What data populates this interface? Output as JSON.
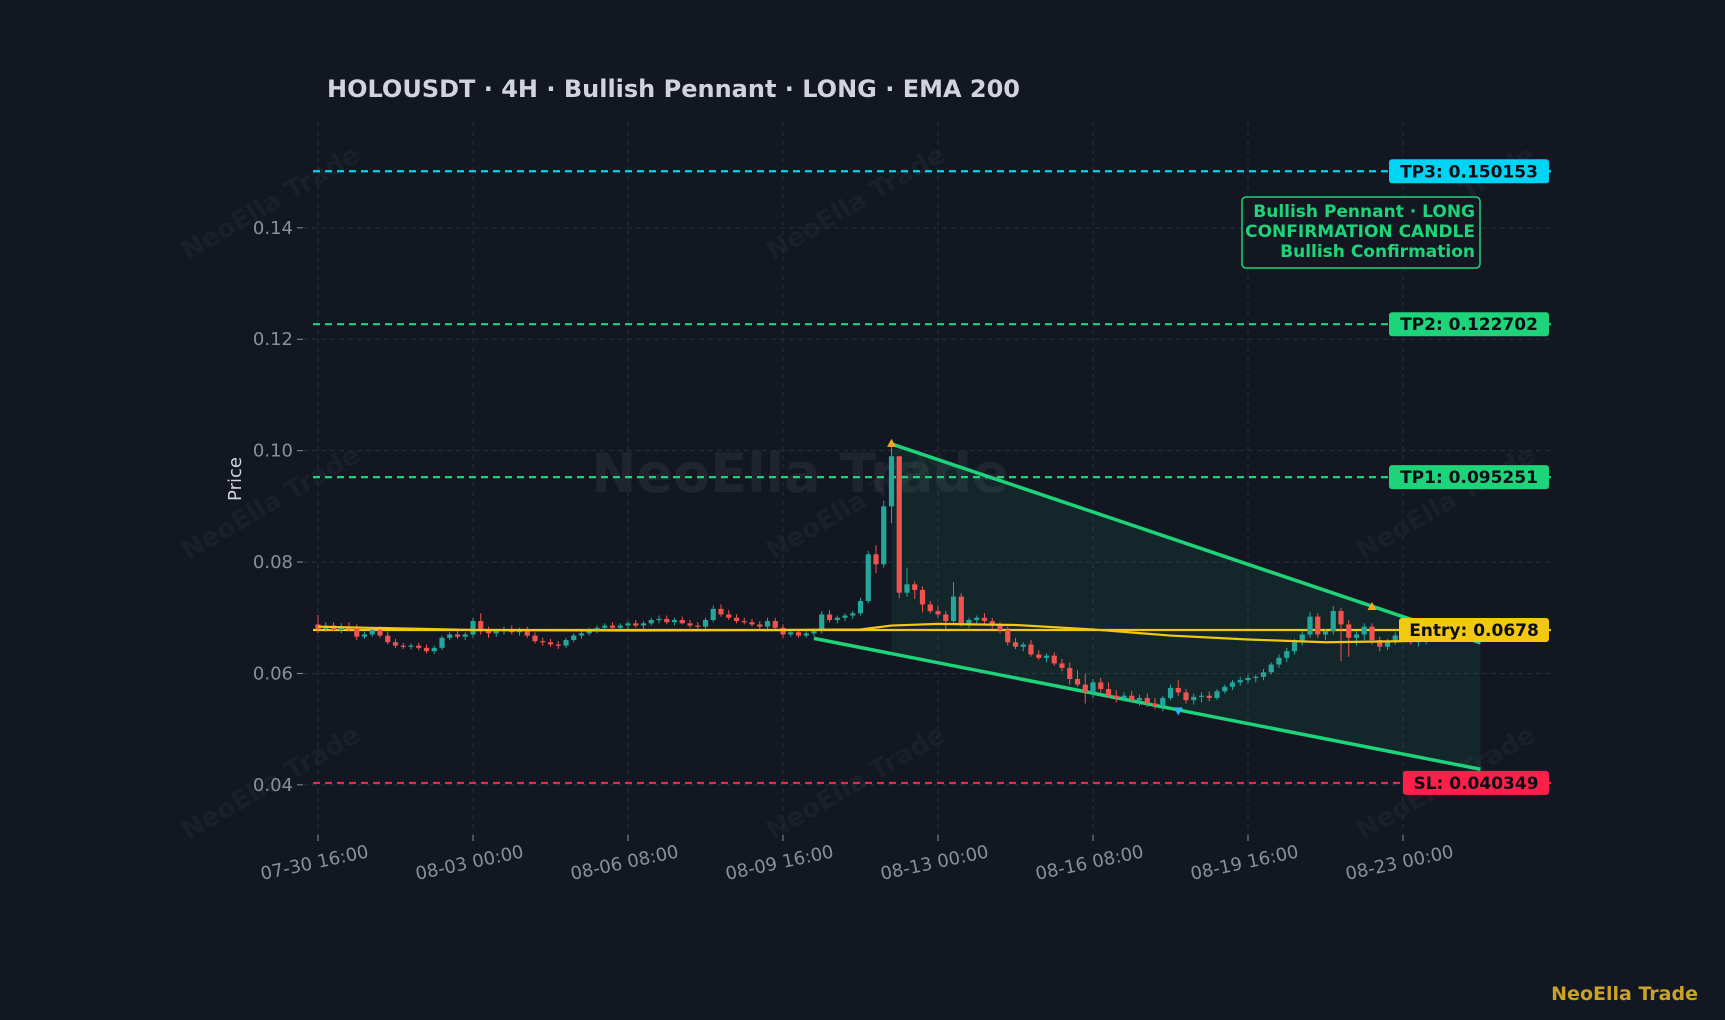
{
  "header": {
    "title": "HOLOUSDT  ·  4H  ·  Bullish Pennant  ·  LONG  ·  EMA 200"
  },
  "brand": "NeoElla Trade",
  "watermark": "NeoElla Trade",
  "annotation": {
    "lines": [
      "Bullish Pennant · LONG",
      "CONFIRMATION CANDLE",
      "Bullish Confirmation"
    ]
  },
  "colors": {
    "background": "#131722",
    "grid": "#2a2e39",
    "candle_up": "#26a69a",
    "candle_down": "#ef5350",
    "pattern": "#1ed47a",
    "ema": "#f2c811",
    "tp3": "#00d4f5",
    "tp2": "#1ed47a",
    "tp1": "#1ed47a",
    "entry": "#f2c811",
    "sl": "#ff1f4b",
    "brand": "#c9a227"
  },
  "chart_data": {
    "type": "candlestick",
    "timeframe": "4H",
    "symbol": "HOLOUSDT",
    "title": "HOLOUSDT  ·  4H  ·  Bullish Pennant  ·  LONG  ·  EMA 200",
    "ylabel": "Price",
    "ylim": [
      0.031,
      0.159
    ],
    "yticks": [
      0.04,
      0.06,
      0.08,
      0.1,
      0.12,
      0.14
    ],
    "ytick_labels": [
      "0.04",
      "0.06",
      "0.08",
      "0.10",
      "0.12",
      "0.14"
    ],
    "xlim_bars": [
      -1,
      169
    ],
    "xticks": [
      {
        "bar": 0,
        "label": "07-30 16:00"
      },
      {
        "bar": 20,
        "label": "08-03 00:00"
      },
      {
        "bar": 40,
        "label": "08-06 08:00"
      },
      {
        "bar": 60,
        "label": "08-09 16:00"
      },
      {
        "bar": 80,
        "label": "08-13 00:00"
      },
      {
        "bar": 100,
        "label": "08-16 08:00"
      },
      {
        "bar": 120,
        "label": "08-19 16:00"
      },
      {
        "bar": 140,
        "label": "08-23 00:00"
      }
    ],
    "grid": true,
    "levels": [
      {
        "key": "tp3",
        "label": "TP3: 0.150153",
        "value": 0.150153
      },
      {
        "key": "tp2",
        "label": "TP2: 0.122702",
        "value": 0.122702
      },
      {
        "key": "tp1",
        "label": "TP1: 0.095251",
        "value": 0.095251
      },
      {
        "key": "entry",
        "label": "Entry: 0.0678",
        "value": 0.0678
      },
      {
        "key": "sl",
        "label": "SL: 0.040349",
        "value": 0.040349
      }
    ],
    "pattern": {
      "name": "Bullish Pennant",
      "upper_line": [
        [
          74,
          0.1012
        ],
        [
          150,
          0.0655
        ]
      ],
      "lower_line": [
        [
          64,
          0.0663
        ],
        [
          150,
          0.0428
        ]
      ],
      "markers": [
        {
          "bar": 74,
          "price": 0.1014,
          "dir": "up"
        },
        {
          "bar": 111,
          "price": 0.0532,
          "dir": "down"
        },
        {
          "bar": 136,
          "price": 0.0721,
          "dir": "up"
        }
      ]
    },
    "ema_200": [
      [
        0,
        0.0684
      ],
      [
        20,
        0.0678
      ],
      [
        40,
        0.0677
      ],
      [
        60,
        0.0678
      ],
      [
        70,
        0.0679
      ],
      [
        74,
        0.0686
      ],
      [
        80,
        0.0689
      ],
      [
        90,
        0.0687
      ],
      [
        100,
        0.0679
      ],
      [
        110,
        0.0668
      ],
      [
        120,
        0.0661
      ],
      [
        130,
        0.0656
      ],
      [
        140,
        0.0658
      ],
      [
        150,
        0.0661
      ]
    ],
    "candles": [
      [
        0.0688,
        0.0705,
        0.0672,
        0.068
      ],
      [
        0.068,
        0.0692,
        0.0674,
        0.0686
      ],
      [
        0.0686,
        0.0692,
        0.0676,
        0.0678
      ],
      [
        0.0678,
        0.069,
        0.0672,
        0.0684
      ],
      [
        0.0684,
        0.0692,
        0.0676,
        0.068
      ],
      [
        0.068,
        0.0688,
        0.066,
        0.0666
      ],
      [
        0.0666,
        0.0675,
        0.0662,
        0.067
      ],
      [
        0.067,
        0.0682,
        0.0666,
        0.0678
      ],
      [
        0.0678,
        0.0685,
        0.0664,
        0.0668
      ],
      [
        0.0668,
        0.0675,
        0.0652,
        0.0656
      ],
      [
        0.0656,
        0.0662,
        0.0646,
        0.065
      ],
      [
        0.065,
        0.0655,
        0.0644,
        0.0648
      ],
      [
        0.0648,
        0.0654,
        0.0643,
        0.065
      ],
      [
        0.065,
        0.0655,
        0.0642,
        0.0646
      ],
      [
        0.0646,
        0.0652,
        0.0636,
        0.064
      ],
      [
        0.064,
        0.065,
        0.0635,
        0.0646
      ],
      [
        0.0646,
        0.0668,
        0.0642,
        0.0664
      ],
      [
        0.0664,
        0.0674,
        0.066,
        0.067
      ],
      [
        0.067,
        0.0676,
        0.0662,
        0.0666
      ],
      [
        0.0666,
        0.0674,
        0.066,
        0.067
      ],
      [
        0.067,
        0.07,
        0.0664,
        0.0694
      ],
      [
        0.0694,
        0.0708,
        0.067,
        0.0676
      ],
      [
        0.0676,
        0.0684,
        0.0664,
        0.0672
      ],
      [
        0.0672,
        0.068,
        0.0666,
        0.0676
      ],
      [
        0.0676,
        0.0684,
        0.067,
        0.0678
      ],
      [
        0.0678,
        0.0686,
        0.067,
        0.0674
      ],
      [
        0.0674,
        0.0682,
        0.0668,
        0.068
      ],
      [
        0.068,
        0.0684,
        0.0664,
        0.0668
      ],
      [
        0.0668,
        0.0674,
        0.0654,
        0.0658
      ],
      [
        0.0658,
        0.0664,
        0.065,
        0.0656
      ],
      [
        0.0656,
        0.0662,
        0.0648,
        0.0652
      ],
      [
        0.0652,
        0.0658,
        0.0644,
        0.065
      ],
      [
        0.065,
        0.0664,
        0.0646,
        0.066
      ],
      [
        0.066,
        0.0672,
        0.0656,
        0.0668
      ],
      [
        0.0668,
        0.0676,
        0.0662,
        0.0672
      ],
      [
        0.0672,
        0.0682,
        0.0668,
        0.0678
      ],
      [
        0.0678,
        0.0686,
        0.0672,
        0.0682
      ],
      [
        0.0682,
        0.069,
        0.0676,
        0.0686
      ],
      [
        0.0686,
        0.0692,
        0.0678,
        0.0682
      ],
      [
        0.0682,
        0.069,
        0.0676,
        0.0686
      ],
      [
        0.0686,
        0.0694,
        0.068,
        0.069
      ],
      [
        0.069,
        0.0696,
        0.0682,
        0.0686
      ],
      [
        0.0686,
        0.0694,
        0.068,
        0.069
      ],
      [
        0.069,
        0.07,
        0.0686,
        0.0696
      ],
      [
        0.0696,
        0.0704,
        0.069,
        0.0698
      ],
      [
        0.0698,
        0.0704,
        0.0688,
        0.0692
      ],
      [
        0.0692,
        0.07,
        0.0686,
        0.0696
      ],
      [
        0.0696,
        0.0702,
        0.0688,
        0.069
      ],
      [
        0.069,
        0.0696,
        0.0682,
        0.0686
      ],
      [
        0.0686,
        0.0692,
        0.068,
        0.0684
      ],
      [
        0.0684,
        0.07,
        0.068,
        0.0696
      ],
      [
        0.0696,
        0.0722,
        0.0692,
        0.0716
      ],
      [
        0.0716,
        0.0724,
        0.0702,
        0.0706
      ],
      [
        0.0706,
        0.0714,
        0.0696,
        0.07
      ],
      [
        0.07,
        0.0706,
        0.069,
        0.0694
      ],
      [
        0.0694,
        0.07,
        0.0688,
        0.0692
      ],
      [
        0.0692,
        0.0698,
        0.0684,
        0.0688
      ],
      [
        0.0688,
        0.0694,
        0.068,
        0.0684
      ],
      [
        0.0684,
        0.07,
        0.068,
        0.0694
      ],
      [
        0.0694,
        0.07,
        0.0678,
        0.0682
      ],
      [
        0.0682,
        0.0688,
        0.0664,
        0.067
      ],
      [
        0.067,
        0.0678,
        0.0666,
        0.0674
      ],
      [
        0.0674,
        0.068,
        0.0664,
        0.0668
      ],
      [
        0.0668,
        0.0676,
        0.0664,
        0.0672
      ],
      [
        0.0672,
        0.068,
        0.0666,
        0.0676
      ],
      [
        0.0676,
        0.0712,
        0.0672,
        0.0706
      ],
      [
        0.0706,
        0.0714,
        0.0692,
        0.0696
      ],
      [
        0.0696,
        0.0704,
        0.069,
        0.07
      ],
      [
        0.07,
        0.0708,
        0.0694,
        0.0704
      ],
      [
        0.0704,
        0.0712,
        0.0698,
        0.0708
      ],
      [
        0.0708,
        0.0736,
        0.0704,
        0.073
      ],
      [
        0.073,
        0.082,
        0.0726,
        0.0814
      ],
      [
        0.0814,
        0.083,
        0.078,
        0.0796
      ],
      [
        0.0796,
        0.091,
        0.079,
        0.09
      ],
      [
        0.09,
        0.1014,
        0.087,
        0.099
      ],
      [
        0.099,
        0.0965,
        0.0735,
        0.0745
      ],
      [
        0.0745,
        0.079,
        0.0738,
        0.076
      ],
      [
        0.076,
        0.0765,
        0.0734,
        0.075
      ],
      [
        0.075,
        0.0756,
        0.071,
        0.0724
      ],
      [
        0.0724,
        0.073,
        0.0708,
        0.0712
      ],
      [
        0.0712,
        0.0722,
        0.07,
        0.0706
      ],
      [
        0.0706,
        0.0712,
        0.068,
        0.0694
      ],
      [
        0.0694,
        0.0764,
        0.069,
        0.0738
      ],
      [
        0.0738,
        0.0744,
        0.0684,
        0.069
      ],
      [
        0.069,
        0.07,
        0.0682,
        0.0696
      ],
      [
        0.0696,
        0.0704,
        0.0686,
        0.07
      ],
      [
        0.07,
        0.0708,
        0.069,
        0.0694
      ],
      [
        0.0694,
        0.07,
        0.068,
        0.0686
      ],
      [
        0.0686,
        0.0692,
        0.0672,
        0.0678
      ],
      [
        0.0678,
        0.0684,
        0.065,
        0.0656
      ],
      [
        0.0656,
        0.0664,
        0.0644,
        0.0648
      ],
      [
        0.0648,
        0.0656,
        0.064,
        0.0652
      ],
      [
        0.0652,
        0.066,
        0.063,
        0.0634
      ],
      [
        0.0634,
        0.0642,
        0.0624,
        0.0628
      ],
      [
        0.0628,
        0.0636,
        0.062,
        0.0632
      ],
      [
        0.0632,
        0.0638,
        0.0614,
        0.0618
      ],
      [
        0.0618,
        0.0626,
        0.0604,
        0.061
      ],
      [
        0.061,
        0.062,
        0.058,
        0.059
      ],
      [
        0.059,
        0.0606,
        0.0576,
        0.058
      ],
      [
        0.058,
        0.06,
        0.0546,
        0.0566
      ],
      [
        0.0566,
        0.059,
        0.0556,
        0.0584
      ],
      [
        0.0584,
        0.0592,
        0.0566,
        0.0572
      ],
      [
        0.0572,
        0.0584,
        0.0556,
        0.056
      ],
      [
        0.056,
        0.057,
        0.0548,
        0.0556
      ],
      [
        0.0556,
        0.0566,
        0.055,
        0.056
      ],
      [
        0.056,
        0.0568,
        0.0548,
        0.0552
      ],
      [
        0.0552,
        0.0562,
        0.0542,
        0.0556
      ],
      [
        0.0556,
        0.0564,
        0.054,
        0.0546
      ],
      [
        0.0546,
        0.0556,
        0.0536,
        0.0542
      ],
      [
        0.0542,
        0.056,
        0.0532,
        0.0556
      ],
      [
        0.0556,
        0.058,
        0.0552,
        0.0574
      ],
      [
        0.0574,
        0.0588,
        0.056,
        0.0566
      ],
      [
        0.0566,
        0.0572,
        0.0546,
        0.0552
      ],
      [
        0.0552,
        0.0564,
        0.0544,
        0.0558
      ],
      [
        0.0558,
        0.0566,
        0.0548,
        0.056
      ],
      [
        0.056,
        0.0568,
        0.055,
        0.0556
      ],
      [
        0.0556,
        0.0572,
        0.0552,
        0.0568
      ],
      [
        0.0568,
        0.058,
        0.0564,
        0.0576
      ],
      [
        0.0576,
        0.0588,
        0.057,
        0.0584
      ],
      [
        0.0584,
        0.0594,
        0.0578,
        0.0588
      ],
      [
        0.0588,
        0.0598,
        0.0582,
        0.0592
      ],
      [
        0.0592,
        0.0598,
        0.0584,
        0.0594
      ],
      [
        0.0594,
        0.0608,
        0.0588,
        0.0602
      ],
      [
        0.0602,
        0.062,
        0.0598,
        0.0616
      ],
      [
        0.0616,
        0.0634,
        0.061,
        0.0628
      ],
      [
        0.0628,
        0.0646,
        0.062,
        0.064
      ],
      [
        0.064,
        0.0662,
        0.0634,
        0.0656
      ],
      [
        0.0656,
        0.0676,
        0.065,
        0.067
      ],
      [
        0.067,
        0.071,
        0.0664,
        0.0702
      ],
      [
        0.0702,
        0.0708,
        0.0664,
        0.067
      ],
      [
        0.067,
        0.068,
        0.066,
        0.0676
      ],
      [
        0.0676,
        0.0721,
        0.067,
        0.0712
      ],
      [
        0.0712,
        0.0718,
        0.0622,
        0.0688
      ],
      [
        0.0688,
        0.0696,
        0.063,
        0.0664
      ],
      [
        0.0664,
        0.0676,
        0.065,
        0.067
      ],
      [
        0.067,
        0.069,
        0.066,
        0.0684
      ],
      [
        0.0684,
        0.069,
        0.0652,
        0.066
      ],
      [
        0.066,
        0.0666,
        0.064,
        0.0648
      ],
      [
        0.0648,
        0.0662,
        0.0642,
        0.0658
      ],
      [
        0.0658,
        0.0674,
        0.0652,
        0.0668
      ],
      [
        0.0668,
        0.0676,
        0.0656,
        0.0662
      ],
      [
        0.0662,
        0.0668,
        0.0652,
        0.0656
      ],
      [
        0.0656,
        0.0664,
        0.0648,
        0.066
      ],
      [
        0.066,
        0.067,
        0.0652,
        0.0664
      ]
    ]
  }
}
